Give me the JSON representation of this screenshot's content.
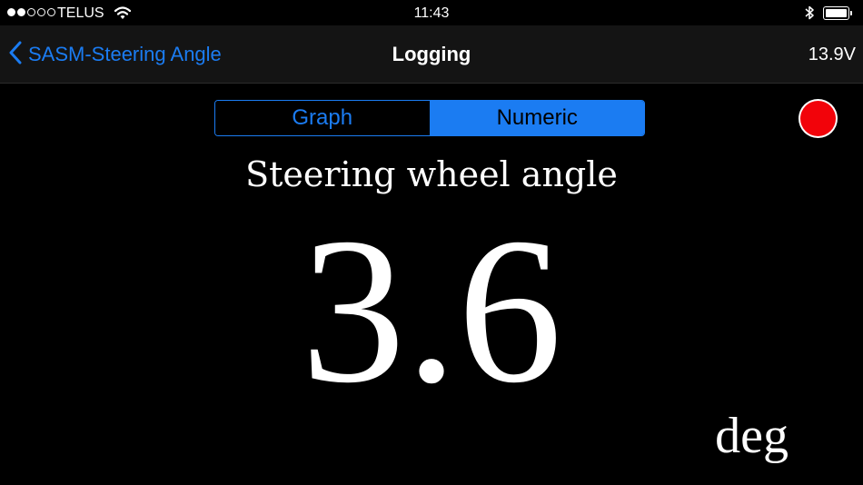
{
  "status_bar": {
    "signal_bars_filled": 2,
    "signal_bars_total": 5,
    "carrier": "TELUS",
    "time": "11:43",
    "battery_level": 1.0
  },
  "nav_bar": {
    "back_label": "SASM-Steering Angle",
    "title": "Logging",
    "voltage": "13.9V"
  },
  "view_toggle": {
    "graph_label": "Graph",
    "numeric_label": "Numeric",
    "selected": "Numeric"
  },
  "reading": {
    "name": "Steering wheel angle",
    "value": "3.6",
    "unit": "deg"
  },
  "colors": {
    "accent": "#1b7cf2",
    "record": "#f2030a",
    "background": "#000000",
    "nav_background": "#141414"
  },
  "icons": {
    "back": "chevron-left-icon",
    "wifi": "wifi-icon",
    "bluetooth": "bluetooth-icon",
    "battery": "battery-icon",
    "record": "record-icon"
  }
}
